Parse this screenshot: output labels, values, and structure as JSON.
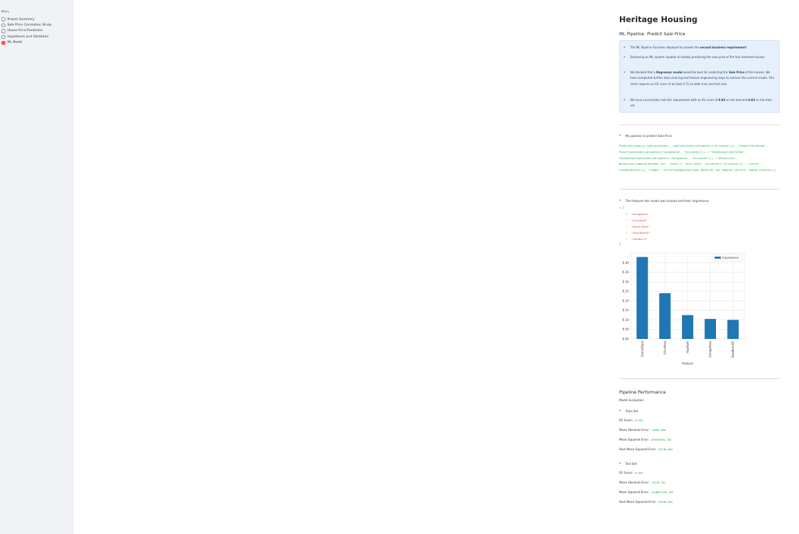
{
  "sidebar": {
    "menu_label": "Menu",
    "items": [
      {
        "label": "Project Summary",
        "selected": false
      },
      {
        "label": "Sale Price Correlation Study",
        "selected": false
      },
      {
        "label": "House Price Prediction",
        "selected": false
      },
      {
        "label": "Hypothesis and Validation",
        "selected": false
      },
      {
        "label": "ML Model",
        "selected": true
      }
    ]
  },
  "main": {
    "title": "Heritage Housing",
    "subtitle": "ML Pipeline: Predict Sale Price",
    "info": {
      "p1": {
        "pre": "The ML Pipeline has been deployed to answer the ",
        "bold": "second business requirement",
        "post": ":"
      },
      "p2": "Delivering an ML system capable of reliably predicting the sale price of the four inherited houses.",
      "p3": {
        "pre": "We decided that a ",
        "bold1": "Regressor model",
        "mid": " would be best for predicting the ",
        "bold2": "Sale Price",
        "post": " of the houses. We have completed further data cleaning and feature engineering steps to achieve the current results. The client requires an R2 score of at least 0.75 on both train and test sets."
      },
      "p4": {
        "pre": "We have successfully met this requirement with an R2 score of ",
        "bold1": "0.93",
        "mid": " on the test and ",
        "bold2": "0.83",
        "post": " on the train set."
      }
    },
    "pipeline_bullet": "ML pipeline to predict Sale Price",
    "pipeline_code": "Pipeline(steps=[('LogTransformer', LogTransformer(variables=['GrLivArea'])), ('PowerTransformer', PowerTransformer(variables=['GarageArea', 'GrLivArea'])), ('YeoJohnsonTransformer', YeoJohnsonTransformer(variables=['GarageArea', 'GrLivArea'])), ('Winsorizer', Winsorizer(capping_method='iqr', fold=1.5, tail='both', variables=['GrLivArea'])), ('scaler', StandardScaler()), ('model', ExtraTreesRegressor(max_depth=10, min_samples_split=6, random_state=0))])",
    "features_bullet": "The features the model was trained and their importance",
    "features_json": {
      "open": "▾ [",
      "close": "]",
      "items": [
        {
          "idx": "0 :",
          "val": "\"GarageArea\""
        },
        {
          "idx": "1 :",
          "val": "\"GrLivArea\""
        },
        {
          "idx": "2 :",
          "val": "\"OverallQual\""
        },
        {
          "idx": "3 :",
          "val": "\"TotalBsmtSF\""
        },
        {
          "idx": "4 :",
          "val": "\"YearBuilt\""
        }
      ]
    },
    "performance": {
      "title": "Pipeline Performance",
      "subtitle": "Model Evaluation",
      "train_bullet": "Train Set",
      "train": [
        {
          "label": "R2 Score:",
          "value": "0.934"
        },
        {
          "label": "Mean Absolute Error:",
          "value": "13869.898"
        },
        {
          "label": "Mean Squared Error:",
          "value": "405493242.182"
        },
        {
          "label": "Root Mean Squared Error:",
          "value": "20136.863"
        }
      ],
      "test_bullet": "Test Set",
      "test": [
        {
          "label": "R2 Score:",
          "value": "0.836"
        },
        {
          "label": "Mean Absolute Error:",
          "value": "20126.352"
        },
        {
          "label": "Mean Squared Error:",
          "value": "1128877256.109"
        },
        {
          "label": "Root Mean Squared Error:",
          "value": "33598.095"
        }
      ]
    }
  },
  "chart_data": {
    "type": "bar",
    "categories": [
      "OverallQual",
      "GrLivArea",
      "YearBuilt",
      "GarageArea",
      "TotalBsmtSF"
    ],
    "series": [
      {
        "name": "importance",
        "values": [
          0.43,
          0.24,
          0.125,
          0.105,
          0.1
        ]
      }
    ],
    "xlabel": "feature",
    "ylabel": "",
    "ylim": [
      0,
      0.45
    ],
    "yticks": [
      0.0,
      0.05,
      0.1,
      0.15,
      0.2,
      0.25,
      0.3,
      0.35,
      0.4
    ],
    "ytick_labels": [
      "0.00",
      "0.05",
      "0.10",
      "0.15",
      "0.20",
      "0.25",
      "0.30",
      "0.35",
      "0.40"
    ],
    "legend": "top-right",
    "grid": true,
    "color": "#1f77b4"
  }
}
